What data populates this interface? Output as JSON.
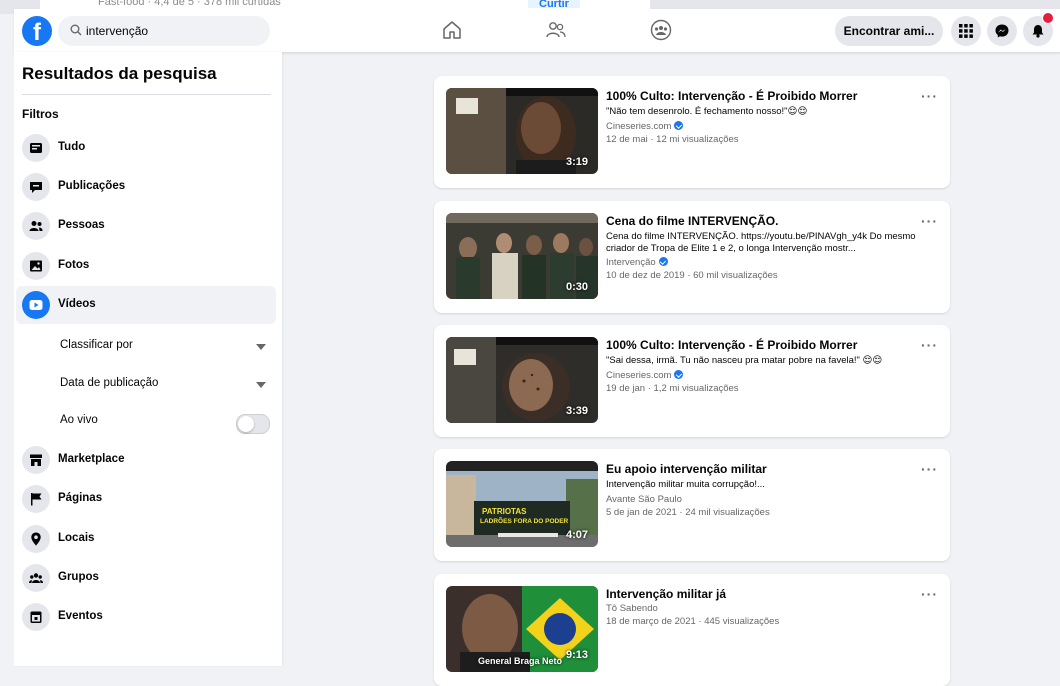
{
  "background_window": {
    "text": "Fast-food · 4,4 de 5 · 378 mil curtidas",
    "button": "Curtir"
  },
  "topbar": {
    "logo": "f",
    "search_value": "intervenção",
    "find_friends": "Encontrar ami...",
    "icons": [
      "home-icon",
      "friends-icon",
      "groups-icon",
      "menu-grid-icon",
      "messenger-icon",
      "notifications-icon"
    ]
  },
  "sidebar": {
    "title": "Resultados da pesquisa",
    "filters_label": "Filtros",
    "items": [
      {
        "label": "Tudo",
        "icon": "all-icon"
      },
      {
        "label": "Publicações",
        "icon": "posts-icon"
      },
      {
        "label": "Pessoas",
        "icon": "people-icon"
      },
      {
        "label": "Fotos",
        "icon": "photos-icon"
      },
      {
        "label": "Vídeos",
        "icon": "videos-icon",
        "active": true
      },
      {
        "label": "Marketplace",
        "icon": "marketplace-icon"
      },
      {
        "label": "Páginas",
        "icon": "pages-icon"
      },
      {
        "label": "Locais",
        "icon": "places-icon"
      },
      {
        "label": "Grupos",
        "icon": "groups-icon"
      },
      {
        "label": "Eventos",
        "icon": "events-icon"
      }
    ],
    "sub_filters": {
      "sort_by": "Classificar por",
      "date": "Data de publicação",
      "live": "Ao vivo",
      "live_on": false
    }
  },
  "results": [
    {
      "title": "100% Culto: Intervenção - É Proibido Morrer",
      "description": "\"Não tem desenrolo. É fechamento nosso!\"😌😌",
      "channel": "Cineseries.com",
      "verified": true,
      "meta": "12 de mai · 12 mi visualizações",
      "duration": "3:19"
    },
    {
      "title": "Cena do filme INTERVENÇÃO.",
      "description": "Cena do filme INTERVENÇÃO. https://youtu.be/PINAVgh_y4k Do mesmo criador de Tropa de Elite 1 e 2, o longa Intervenção mostr...",
      "channel": "Intervenção",
      "verified": true,
      "meta": "10 de dez de 2019 · 60 mil visualizações",
      "duration": "0:30"
    },
    {
      "title": "100% Culto: Intervenção - É Proibido Morrer",
      "description": "\"Sai dessa, irmã. Tu não nasceu pra matar pobre na favela!\" 😌😌",
      "channel": "Cineseries.com",
      "verified": true,
      "meta": "19 de jan · 1,2 mi visualizações",
      "duration": "3:39"
    },
    {
      "title": "Eu apoio intervenção militar",
      "description": "Intervenção militar muita corrupção!...",
      "channel": "Avante São Paulo",
      "verified": false,
      "meta": "5 de jan de 2021 · 24 mil visualizações",
      "duration": "4:07",
      "thumb_text": [
        "PATRIOTAS",
        "LADRÕES FORA DO PODER"
      ]
    },
    {
      "title": "Intervenção militar já",
      "description": "",
      "channel": "Tô Sabendo",
      "verified": false,
      "meta": "18 de março de 2021 · 445 visualizações",
      "duration": "9:13",
      "thumb_text": [
        "General Braga Neto"
      ]
    }
  ],
  "colors": {
    "accent": "#1877f2",
    "page_bg": "#f0f2f5",
    "secondary_text": "#65676b"
  }
}
